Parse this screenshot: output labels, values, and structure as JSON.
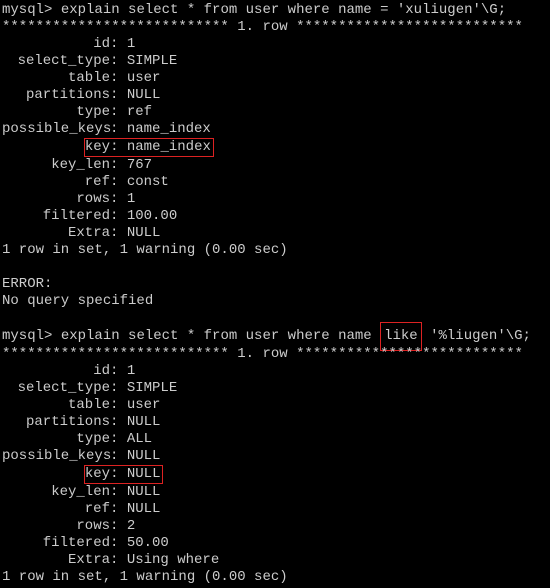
{
  "prompt": "mysql>",
  "queries": [
    {
      "cmd_pre": "explain select * from user where name = 'xuliugen'\\G;",
      "like_word": "",
      "cmd_post": "",
      "row_header_pre": "*************************** 1. row ",
      "row_header_post": "***************************",
      "rows": [
        {
          "label": "id",
          "value": "1"
        },
        {
          "label": "select_type",
          "value": "SIMPLE"
        },
        {
          "label": "table",
          "value": "user"
        },
        {
          "label": "partitions",
          "value": "NULL"
        },
        {
          "label": "type",
          "value": "ref"
        },
        {
          "label": "possible_keys",
          "value": "name_index"
        },
        {
          "label": "key",
          "value": "name_index",
          "highlight": true
        },
        {
          "label": "key_len",
          "value": "767"
        },
        {
          "label": "ref",
          "value": "const"
        },
        {
          "label": "rows",
          "value": "1"
        },
        {
          "label": "filtered",
          "value": "100.00"
        },
        {
          "label": "Extra",
          "value": "NULL"
        }
      ],
      "summary": "1 row in set, 1 warning (0.00 sec)",
      "error_lines": [
        "ERROR:",
        "No query specified"
      ]
    },
    {
      "cmd_pre": "explain select * from user where name ",
      "like_word": "like",
      "cmd_post": " '%liugen'\\G;",
      "row_header_pre": "*************************** 1. row ",
      "row_header_post": "***************************",
      "rows": [
        {
          "label": "id",
          "value": "1"
        },
        {
          "label": "select_type",
          "value": "SIMPLE"
        },
        {
          "label": "table",
          "value": "user"
        },
        {
          "label": "partitions",
          "value": "NULL"
        },
        {
          "label": "type",
          "value": "ALL"
        },
        {
          "label": "possible_keys",
          "value": "NULL"
        },
        {
          "label": "key",
          "value": "NULL",
          "highlight": true
        },
        {
          "label": "key_len",
          "value": "NULL"
        },
        {
          "label": "ref",
          "value": "NULL"
        },
        {
          "label": "rows",
          "value": "2"
        },
        {
          "label": "filtered",
          "value": "50.00"
        },
        {
          "label": "Extra",
          "value": "Using where"
        }
      ],
      "summary": "1 row in set, 1 warning (0.00 sec)",
      "error_lines": []
    }
  ]
}
